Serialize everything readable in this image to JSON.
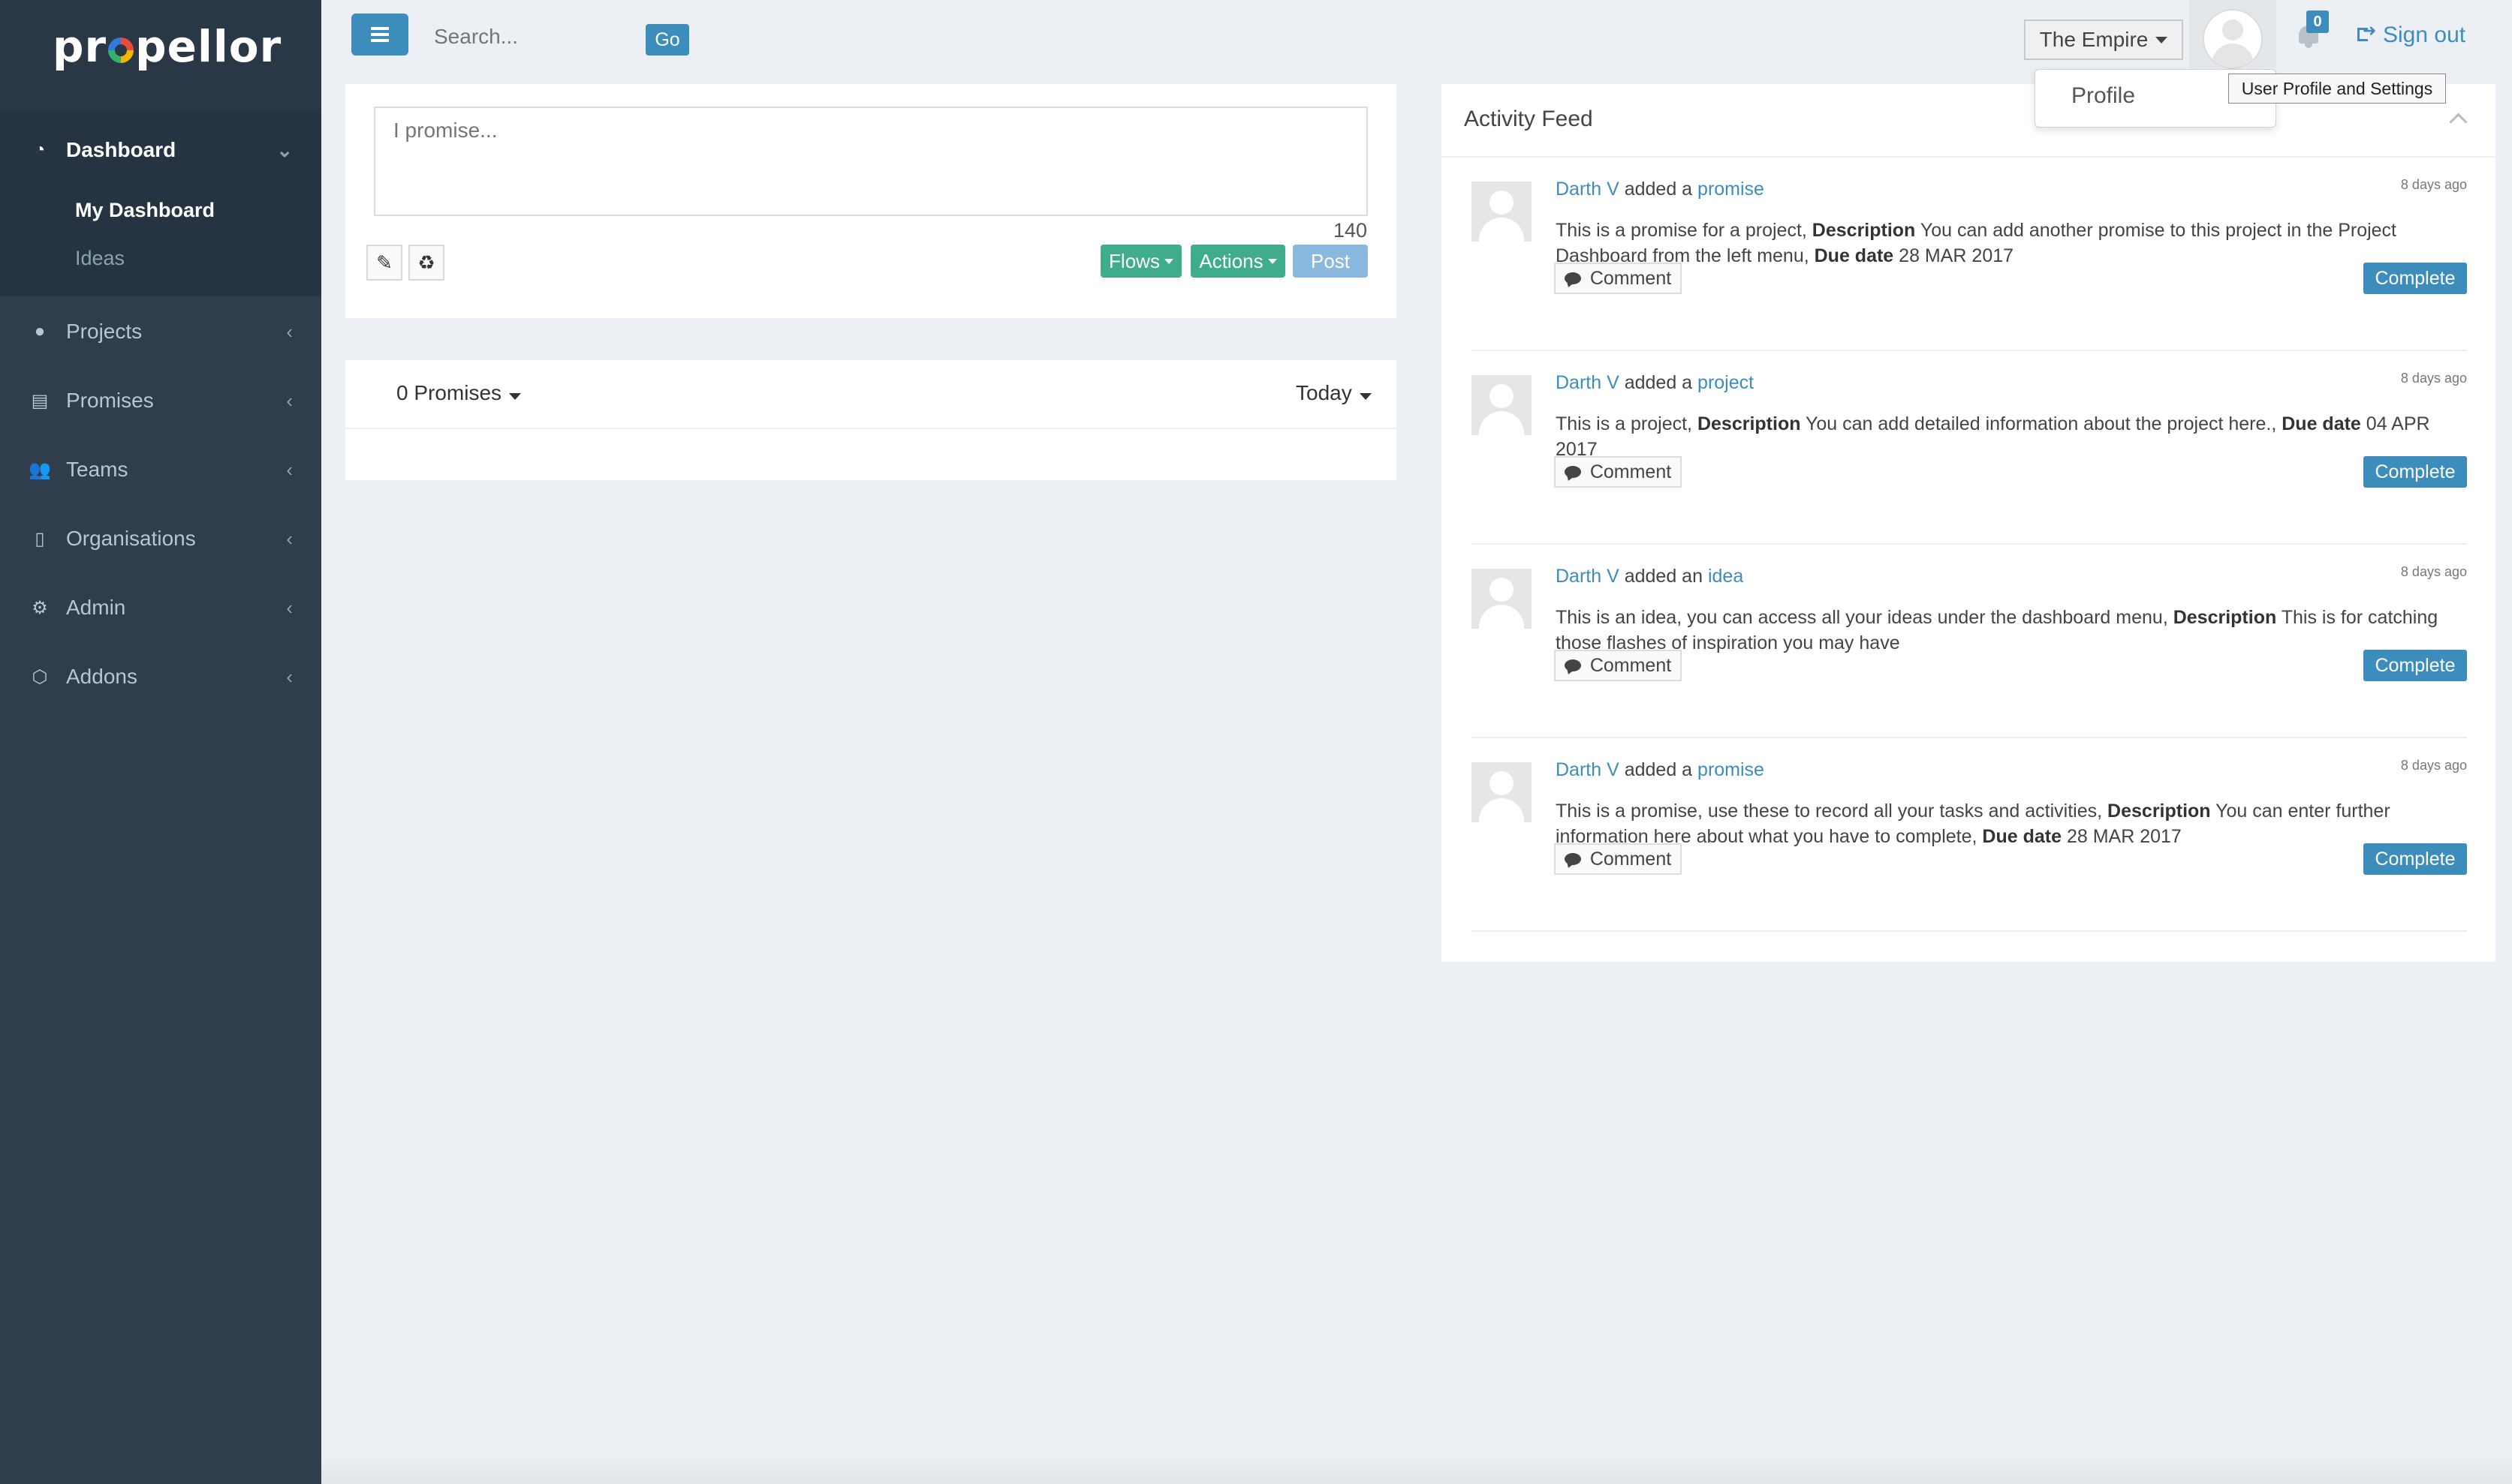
{
  "app": {
    "logo": "propellor"
  },
  "sidebar": {
    "items": [
      {
        "label": "Dashboard",
        "icon": "dashboard-icon"
      },
      {
        "label": "Projects",
        "icon": "projects-icon"
      },
      {
        "label": "Promises",
        "icon": "promises-icon"
      },
      {
        "label": "Teams",
        "icon": "teams-icon"
      },
      {
        "label": "Organisations",
        "icon": "organisations-icon"
      },
      {
        "label": "Admin",
        "icon": "gear-icon"
      },
      {
        "label": "Addons",
        "icon": "addons-icon"
      }
    ],
    "dashboard_sub": [
      {
        "label": "My Dashboard"
      },
      {
        "label": "Ideas"
      }
    ]
  },
  "header": {
    "search_placeholder": "Search...",
    "go_label": "Go",
    "org_name": "The Empire",
    "notifications_count": "0",
    "signout_label": "Sign out",
    "profile_menu_item": "Profile",
    "tooltip": "User Profile and Settings"
  },
  "composer": {
    "placeholder": "I promise...",
    "char_counter": "140",
    "flows_label": "Flows",
    "actions_label": "Actions",
    "post_label": "Post"
  },
  "promises": {
    "count_label": "0 Promises",
    "period_label": "Today"
  },
  "feed": {
    "title": "Activity Feed",
    "items": [
      {
        "user": "Darth V",
        "verb": "added a",
        "object": "promise",
        "time": "8 days ago",
        "body_intro": "This is a promise for a project,",
        "desc_label": "Description",
        "desc_text": "You can add another promise to this project in the Project Dashboard from the left menu,",
        "due_label": "Due date",
        "due_value": "28 MAR 2017",
        "comment_label": "Comment",
        "complete_label": "Complete"
      },
      {
        "user": "Darth V",
        "verb": "added a",
        "object": "project",
        "time": "8 days ago",
        "body_intro": "This is a project,",
        "desc_label": "Description",
        "desc_text": "You can add detailed information about the project here.,",
        "due_label": "Due date",
        "due_value": "04 APR 2017",
        "comment_label": "Comment",
        "complete_label": "Complete"
      },
      {
        "user": "Darth V",
        "verb": "added an",
        "object": "idea",
        "time": "8 days ago",
        "body_intro": "This is an idea, you can access all your ideas under the dashboard menu,",
        "desc_label": "Description",
        "desc_text": "This is for catching those flashes of inspiration you may have",
        "due_label": "",
        "due_value": "",
        "comment_label": "Comment",
        "complete_label": "Complete"
      },
      {
        "user": "Darth V",
        "verb": "added a",
        "object": "promise",
        "time": "8 days ago",
        "body_intro": "This is a promise, use these to record all your tasks and activities,",
        "desc_label": "Description",
        "desc_text": "You can enter further information here about what you have to complete,",
        "due_label": "Due date",
        "due_value": "28 MAR 2017",
        "comment_label": "Comment",
        "complete_label": "Complete"
      }
    ]
  }
}
